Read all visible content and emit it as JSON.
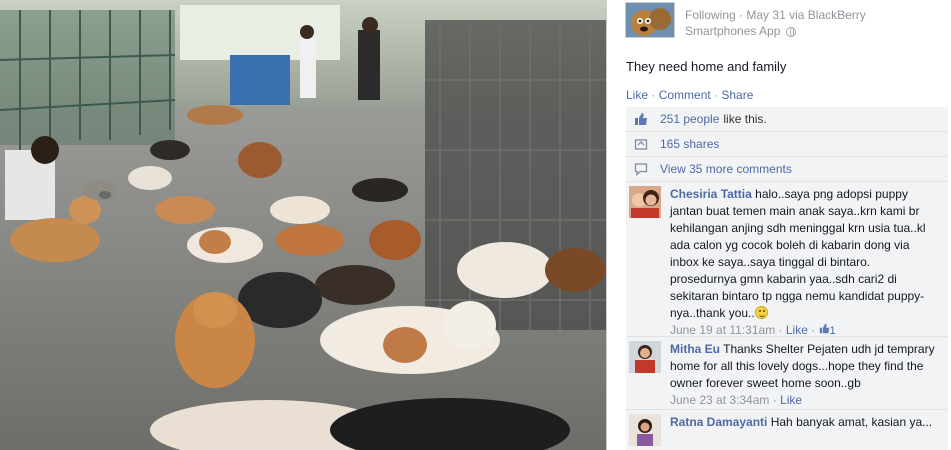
{
  "post": {
    "status_label": "Following",
    "date": "May 31",
    "via_text": "via BlackBerry",
    "app_name": "Smartphones App",
    "message": "They need home and family"
  },
  "actions": {
    "like": "Like",
    "comment": "Comment",
    "share": "Share"
  },
  "summary": {
    "likes_count": "251 people",
    "likes_suffix": "like this.",
    "shares": "165 shares",
    "view_comments": "View 35 more comments"
  },
  "comments": [
    {
      "author": "Chesiria Tattia",
      "text": "halo..saya png adopsi puppy jantan buat temen main anak saya..krn kami br kehilangan anjing sdh meninggal krn usia tua..kl ada calon yg cocok boleh di kabarin dong via inbox ke saya..saya tinggal di bintaro. prosedurnya gmn kabarin yaa..sdh cari2 di sekitaran bintaro tp ngga nemu kandidat puppy-nya..thank you..",
      "time": "June 19 at 11:31am",
      "like": "Like",
      "like_count": "1"
    },
    {
      "author": "Mitha Eu",
      "text": "Thanks Shelter Pejaten udh jd temprary home for all this lovely dogs...hope they find the owner forever sweet home soon..gb",
      "time": "June 23 at 3:34am",
      "like": "Like"
    },
    {
      "author": "Ratna Damayanti",
      "text": "Hah banyak amat, kasian ya..."
    }
  ],
  "colors": {
    "link": "#4e6aa5",
    "meta": "#90949c",
    "panel": "#f2f3f5"
  }
}
